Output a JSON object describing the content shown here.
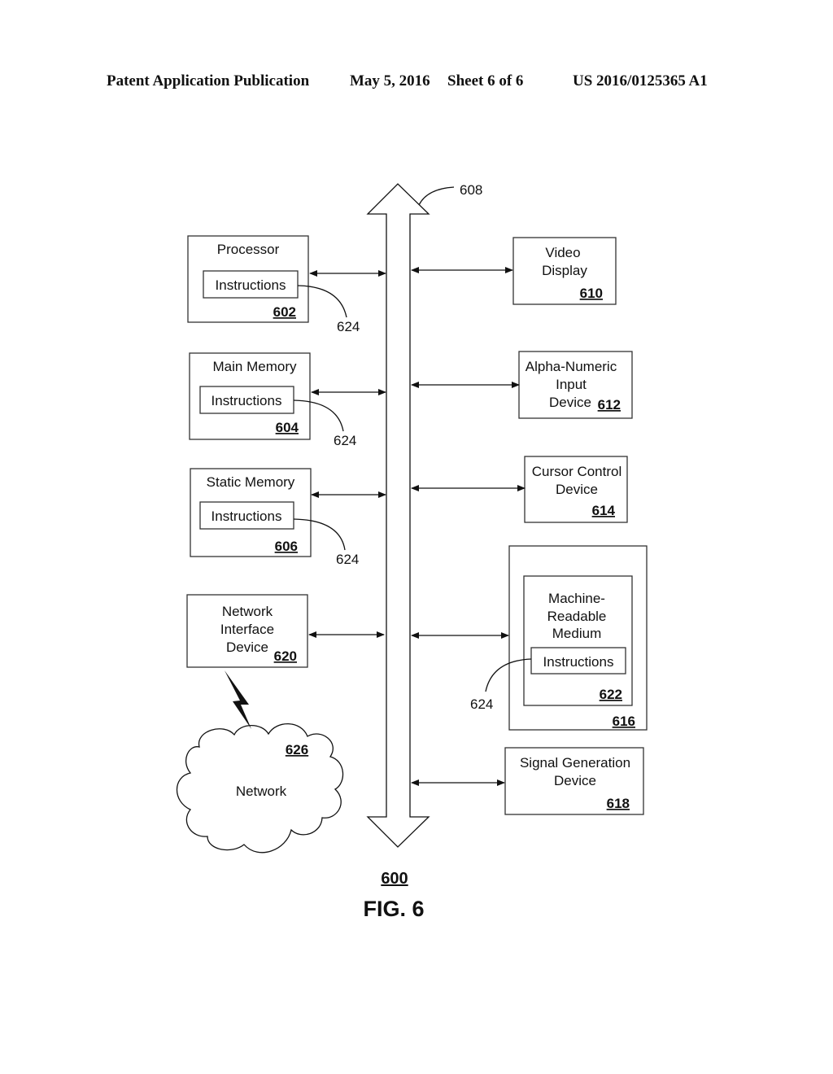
{
  "header": {
    "publication": "Patent Application Publication",
    "date": "May 5, 2016",
    "sheet": "Sheet 6 of 6",
    "number": "US 2016/0125365 A1"
  },
  "figure": {
    "ref": "600",
    "caption": "FIG. 6",
    "bus_ref": "608",
    "instructions_ref": "624",
    "left_components": [
      {
        "label_lines": [
          "Processor"
        ],
        "inner": "Instructions",
        "ref": "602"
      },
      {
        "label_lines": [
          "Main Memory"
        ],
        "inner": "Instructions",
        "ref": "604"
      },
      {
        "label_lines": [
          "Static Memory"
        ],
        "inner": "Instructions",
        "ref": "606"
      },
      {
        "label_lines": [
          "Network",
          "Interface",
          "Device"
        ],
        "ref": "620"
      }
    ],
    "right_components": [
      {
        "label_lines": [
          "Video",
          "Display"
        ],
        "ref": "610"
      },
      {
        "label_lines": [
          "Alpha-Numeric",
          "Input",
          "Device"
        ],
        "ref": "612"
      },
      {
        "label_lines": [
          "Cursor Control",
          "Device"
        ],
        "ref": "614"
      },
      {
        "outer_ref": "616",
        "label_lines": [
          "Machine-",
          "Readable",
          "Medium"
        ],
        "inner": "Instructions",
        "ref": "622"
      },
      {
        "label_lines": [
          "Signal Generation",
          "Device"
        ],
        "ref": "618"
      }
    ],
    "network": {
      "label": "Network",
      "ref": "626"
    }
  }
}
